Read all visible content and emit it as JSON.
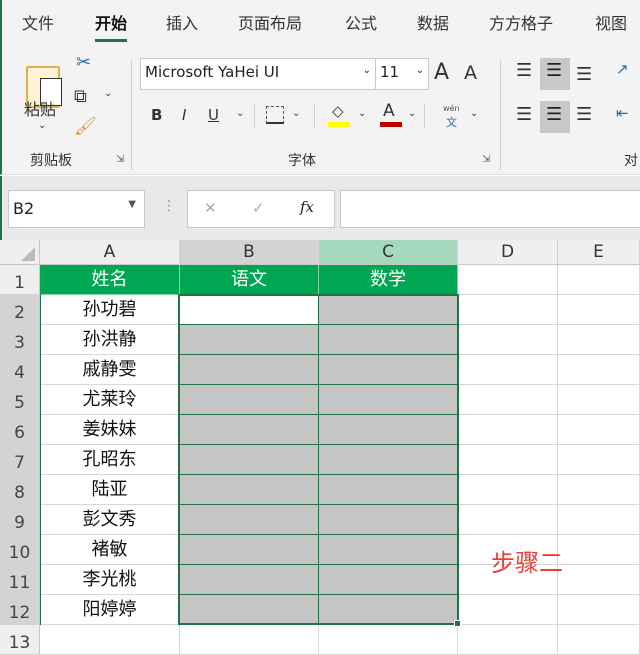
{
  "menu": {
    "tabs": [
      "文件",
      "开始",
      "插入",
      "页面布局",
      "公式",
      "数据",
      "方方格子",
      "视图"
    ],
    "active": "开始"
  },
  "ribbon": {
    "clipboard": {
      "paste_label": "粘贴",
      "group_label": "剪贴板"
    },
    "font": {
      "font_name": "Microsoft YaHei UI",
      "font_size": "11",
      "grow": "A",
      "shrink": "A",
      "bold": "B",
      "italic": "I",
      "underline": "U",
      "font_color": "A",
      "phonetic_top": "wén",
      "phonetic_bottom": "文",
      "group_label": "字体",
      "fill_color": "#ffff00",
      "text_color": "#c00000"
    },
    "alignment": {
      "group_label": "对"
    }
  },
  "formula_bar": {
    "name_box": "B2",
    "cancel": "✕",
    "enter": "✓",
    "fx": "fx",
    "formula": ""
  },
  "sheet": {
    "columns": [
      "A",
      "B",
      "C",
      "D",
      "E"
    ],
    "rows": [
      "1",
      "2",
      "3",
      "4",
      "5",
      "6",
      "7",
      "8",
      "9",
      "10",
      "11",
      "12",
      "13"
    ],
    "headers": [
      "姓名",
      "语文",
      "数学"
    ],
    "names": [
      "孙功碧",
      "孙洪静",
      "戚静雯",
      "尤莱玲",
      "姜妹妹",
      "孔昭东",
      "陆亚",
      "彭文秀",
      "褚敏",
      "李光桃",
      "阳婷婷"
    ],
    "selection": "B2:C12",
    "header_fill": "#00a651",
    "note": "步骤二",
    "note_color": "#e8413a"
  }
}
